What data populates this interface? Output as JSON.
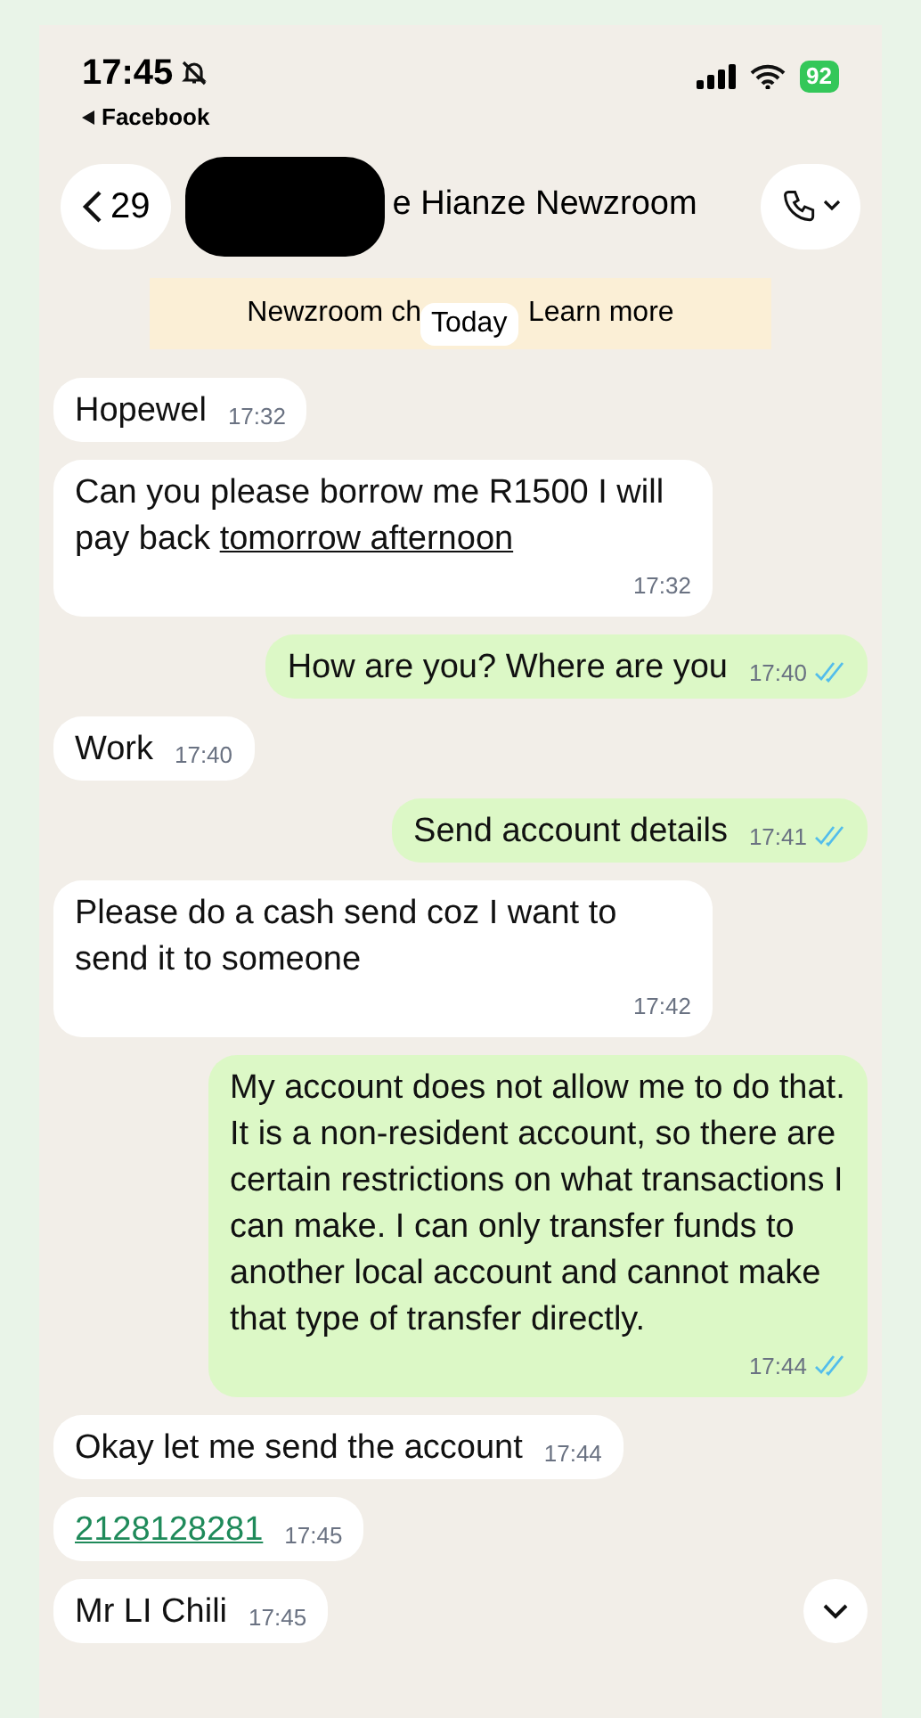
{
  "status_bar": {
    "time": "17:45",
    "muted": true,
    "back_app": "Facebook",
    "battery": "92"
  },
  "header": {
    "back_count": "29",
    "name": "e Hianze Newzroom"
  },
  "banner": {
    "text": "Newzroom ch",
    "link": "Learn more"
  },
  "date_chip": "Today",
  "messages": [
    {
      "kind": "incoming",
      "text": "Hopewel",
      "time": "17:32"
    },
    {
      "kind": "incoming",
      "text": "Can you please borrow me R1500 I will pay back ",
      "link": "tomorrow afternoon",
      "time": "17:32"
    },
    {
      "kind": "outgoing",
      "text": "How are you? Where are you",
      "time": "17:40",
      "read": true
    },
    {
      "kind": "incoming",
      "text": "Work",
      "time": "17:40"
    },
    {
      "kind": "outgoing",
      "text": "Send account details",
      "time": "17:41",
      "read": true
    },
    {
      "kind": "incoming",
      "text": "Please do a cash send coz I want to send it to someone",
      "time": "17:42"
    },
    {
      "kind": "outgoing",
      "text": "My account does not allow me to do that. It is a non-resident account, so there are certain restrictions on what transactions I can make. I can only transfer funds to another local account and cannot make that type of transfer directly.",
      "time": "17:44",
      "read": true
    },
    {
      "kind": "incoming",
      "text": "Okay let me send the account",
      "time": "17:44"
    },
    {
      "kind": "incoming",
      "link": "2128128281",
      "time": "17:45"
    },
    {
      "kind": "incoming",
      "text": "Mr LI Chili",
      "time": "17:45"
    }
  ]
}
